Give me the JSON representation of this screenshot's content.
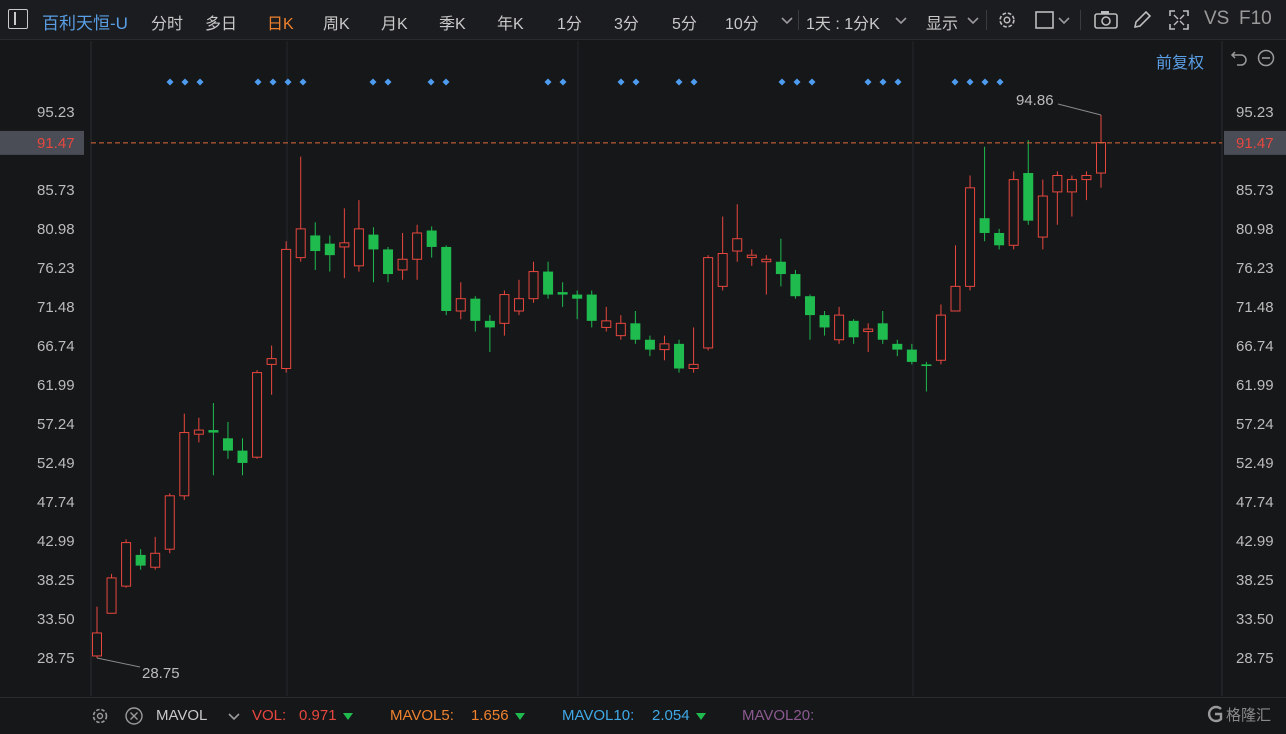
{
  "toolbar": {
    "stock_name": "百利天恒-U",
    "periods": [
      "分时",
      "多日",
      "日K",
      "周K",
      "月K",
      "季K",
      "年K",
      "1分",
      "3分",
      "5分",
      "10分"
    ],
    "active_period": "日K",
    "interval_label": "1天 : 1分K",
    "display_label": "显示",
    "compare_label": "VS",
    "f10_label": "F10"
  },
  "subheader": {
    "adjust_label": "前复权"
  },
  "chart_data": {
    "type": "candlestick",
    "y_ticks": [
      95.23,
      91.47,
      85.73,
      80.98,
      76.23,
      71.48,
      66.74,
      61.99,
      57.24,
      52.49,
      47.74,
      42.99,
      38.25,
      33.5,
      28.75
    ],
    "y_tick_labels": [
      "95.23",
      "91.47",
      "85.73",
      "80.98",
      "76.23",
      "71.48",
      "66.74",
      "61.99",
      "57.24",
      "52.49",
      "47.74",
      "42.99",
      "38.25",
      "33.50",
      "28.75"
    ],
    "current_price": "91.47",
    "high_label": "94.86",
    "low_label": "28.75",
    "up_color": "#e8473e",
    "down_color": "#1fbb4f",
    "candles": [
      [
        29.0,
        31.8,
        28.75,
        35.0
      ],
      [
        34.2,
        38.5,
        34.2,
        39.0
      ],
      [
        37.5,
        42.8,
        37.3,
        43.2
      ],
      [
        41.3,
        40.0,
        39.5,
        42.0
      ],
      [
        39.8,
        41.5,
        39.5,
        43.5
      ],
      [
        42.0,
        48.5,
        41.5,
        48.8
      ],
      [
        48.5,
        56.2,
        48.0,
        58.5
      ],
      [
        56.0,
        56.5,
        55.0,
        58.0
      ],
      [
        56.5,
        56.2,
        51.0,
        59.8
      ],
      [
        55.5,
        54.0,
        53.0,
        57.5
      ],
      [
        54.0,
        52.5,
        51.0,
        55.5
      ],
      [
        53.2,
        63.5,
        53.0,
        63.8
      ],
      [
        64.5,
        65.2,
        60.8,
        66.8
      ],
      [
        64.0,
        78.5,
        63.5,
        79.5
      ],
      [
        77.5,
        81.0,
        77.0,
        89.8
      ],
      [
        80.2,
        78.3,
        76.0,
        81.8
      ],
      [
        79.2,
        77.8,
        75.8,
        80.2
      ],
      [
        78.8,
        79.3,
        75.0,
        83.5
      ],
      [
        76.5,
        81.0,
        75.8,
        84.5
      ],
      [
        80.3,
        78.5,
        74.5,
        81.2
      ],
      [
        78.5,
        75.5,
        74.5,
        78.8
      ],
      [
        76.0,
        77.3,
        74.8,
        80.5
      ],
      [
        77.3,
        80.5,
        74.8,
        81.5
      ],
      [
        80.8,
        78.8,
        77.5,
        81.3
      ],
      [
        78.8,
        71.0,
        70.5,
        79.0
      ],
      [
        71.0,
        72.5,
        70.0,
        74.5
      ],
      [
        72.5,
        69.8,
        68.5,
        72.8
      ],
      [
        69.8,
        69.0,
        66.0,
        70.5
      ],
      [
        69.5,
        73.0,
        68.0,
        73.5
      ],
      [
        71.0,
        72.5,
        70.5,
        74.8
      ],
      [
        72.5,
        75.8,
        72.0,
        77.0
      ],
      [
        75.8,
        73.0,
        72.5,
        77.0
      ],
      [
        73.3,
        73.0,
        71.5,
        74.5
      ],
      [
        73.0,
        72.5,
        70.0,
        73.5
      ],
      [
        73.0,
        69.8,
        69.0,
        73.5
      ],
      [
        69.0,
        69.8,
        68.5,
        71.5
      ],
      [
        68.0,
        69.5,
        67.5,
        70.5
      ],
      [
        69.5,
        67.5,
        67.0,
        71.0
      ],
      [
        67.5,
        66.3,
        65.5,
        68.0
      ],
      [
        66.3,
        67.0,
        65.0,
        68.0
      ],
      [
        67.0,
        64.0,
        63.5,
        67.5
      ],
      [
        64.0,
        64.5,
        63.5,
        69.0
      ],
      [
        66.5,
        77.5,
        66.2,
        77.8
      ],
      [
        74.0,
        78.0,
        73.5,
        82.5
      ],
      [
        78.3,
        79.8,
        77.0,
        84.0
      ],
      [
        77.5,
        77.8,
        76.5,
        78.5
      ],
      [
        77.0,
        77.3,
        73.0,
        77.8
      ],
      [
        77.0,
        75.5,
        74.0,
        79.8
      ],
      [
        75.5,
        72.8,
        72.5,
        76.0
      ],
      [
        72.8,
        70.5,
        67.5,
        73.0
      ],
      [
        70.5,
        69.0,
        68.0,
        71.0
      ],
      [
        67.5,
        70.5,
        67.0,
        71.5
      ],
      [
        69.8,
        67.8,
        67.0,
        70.0
      ],
      [
        68.5,
        68.8,
        66.0,
        69.5
      ],
      [
        69.5,
        67.5,
        67.0,
        71.0
      ],
      [
        67.0,
        66.3,
        65.5,
        67.5
      ],
      [
        66.3,
        64.8,
        64.5,
        67.0
      ],
      [
        64.5,
        64.3,
        61.2,
        64.8
      ],
      [
        65.0,
        70.5,
        64.5,
        71.8
      ],
      [
        71.0,
        74.0,
        71.0,
        79.0
      ],
      [
        74.0,
        86.0,
        73.5,
        87.5
      ],
      [
        82.3,
        80.5,
        79.5,
        91.0
      ],
      [
        80.5,
        79.0,
        78.5,
        81.0
      ],
      [
        79.0,
        87.0,
        78.5,
        88.0
      ],
      [
        87.8,
        82.0,
        81.5,
        91.8
      ],
      [
        80.0,
        85.0,
        78.5,
        87.0
      ],
      [
        85.5,
        87.5,
        81.5,
        88.0
      ],
      [
        85.5,
        87.0,
        82.5,
        87.5
      ],
      [
        87.0,
        87.5,
        84.5,
        88.0
      ],
      [
        87.8,
        91.5,
        86.0,
        94.86
      ]
    ],
    "event_marker_groups": [
      [
        170,
        185,
        200
      ],
      [
        258,
        273,
        288,
        303
      ],
      [
        373,
        388
      ],
      [
        431,
        446
      ],
      [
        548,
        563
      ],
      [
        621,
        636
      ],
      [
        679,
        694
      ],
      [
        782,
        797,
        812
      ],
      [
        868,
        883,
        898
      ],
      [
        955,
        970,
        985,
        1000
      ]
    ]
  },
  "bottombar": {
    "indicator": "MAVOL",
    "vol_label": "VOL:",
    "vol_value": "0.971",
    "mavol5_label": "MAVOL5:",
    "mavol5_value": "1.656",
    "mavol10_label": "MAVOL10:",
    "mavol10_value": "2.054",
    "mavol20_label": "MAVOL20:",
    "logo_text": "格隆汇"
  },
  "colors": {
    "accent_blue": "#5a9fe6",
    "active_orange": "#f0822e",
    "vol_red": "#e8473e",
    "mavol5": "#f0822e",
    "mavol10": "#3fa9e8",
    "mavol20": "#a85fb5"
  }
}
